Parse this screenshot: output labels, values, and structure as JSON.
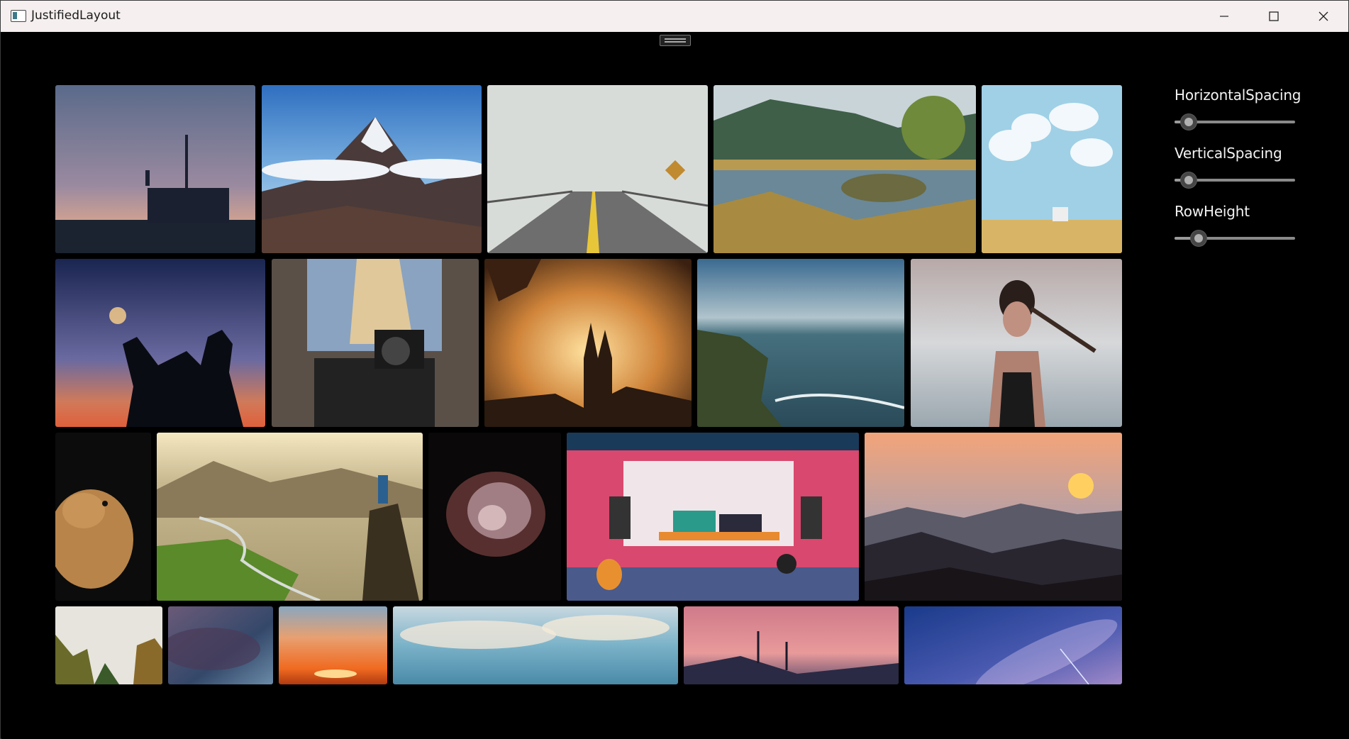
{
  "window": {
    "title": "JustifiedLayout",
    "controls": {
      "minimize": "minimize-icon",
      "maximize": "maximize-icon",
      "close": "close-icon"
    }
  },
  "settings": [
    {
      "label": "HorizontalSpacing",
      "value": 0.12
    },
    {
      "label": "VerticalSpacing",
      "value": 0.12
    },
    {
      "label": "RowHeight",
      "value": 0.2
    }
  ],
  "gallery": {
    "rows": [
      [
        "night-sky-tower",
        "mountain-peak",
        "foggy-road",
        "lake-landscape",
        "clouds-house"
      ],
      [
        "sparkler-silhouette",
        "woman-camera",
        "church-sunset",
        "sea-cliff",
        "woman-beach"
      ],
      [
        "cat-closeup",
        "river-valley-hiker",
        "nebula",
        "recording-studio",
        "mountain-sunset"
      ],
      [
        "forest-sky",
        "storm-clouds",
        "orange-sunset",
        "blue-sky-clouds",
        "power-lines-dusk",
        "milky-way"
      ]
    ]
  },
  "colors": {
    "titlebar": "#f5efef",
    "background": "#000000",
    "label": "#f2f2f2"
  }
}
